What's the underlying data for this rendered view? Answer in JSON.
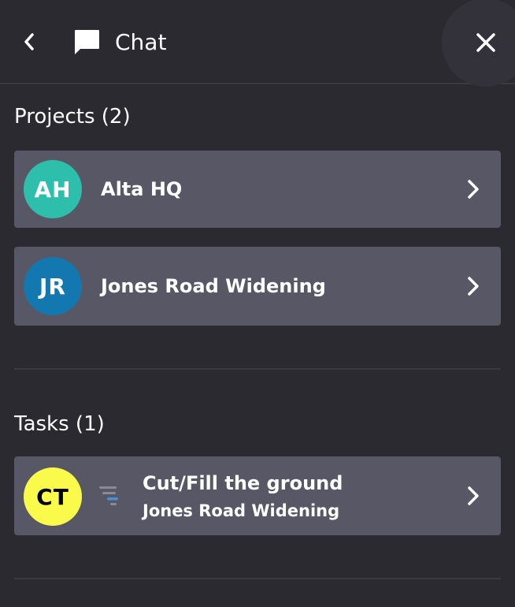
{
  "header": {
    "title": "Chat",
    "back_icon": "chevron-left-icon",
    "chat_icon": "chat-bubble-icon",
    "close_icon": "close-icon"
  },
  "projects": {
    "heading": "Projects (2)",
    "items": [
      {
        "initials": "AH",
        "name": "Alta HQ",
        "avatar_color": "#2ebfac",
        "text_color": "#ffffff"
      },
      {
        "initials": "JR",
        "name": "Jones Road Widening",
        "avatar_color": "#1478b0",
        "text_color": "#ffffff"
      }
    ]
  },
  "tasks": {
    "heading": "Tasks (1)",
    "items": [
      {
        "initials": "CT",
        "title": "Cut/Fill the ground",
        "project": "Jones Road Widening",
        "avatar_color": "#fafa4a",
        "text_color": "#000000",
        "priority_icon": "priority-low-icon"
      }
    ]
  },
  "colors": {
    "background": "#2b2a30",
    "card": "#575765",
    "divider": "#3b3a41",
    "priority_accent": "#4a90d9"
  }
}
